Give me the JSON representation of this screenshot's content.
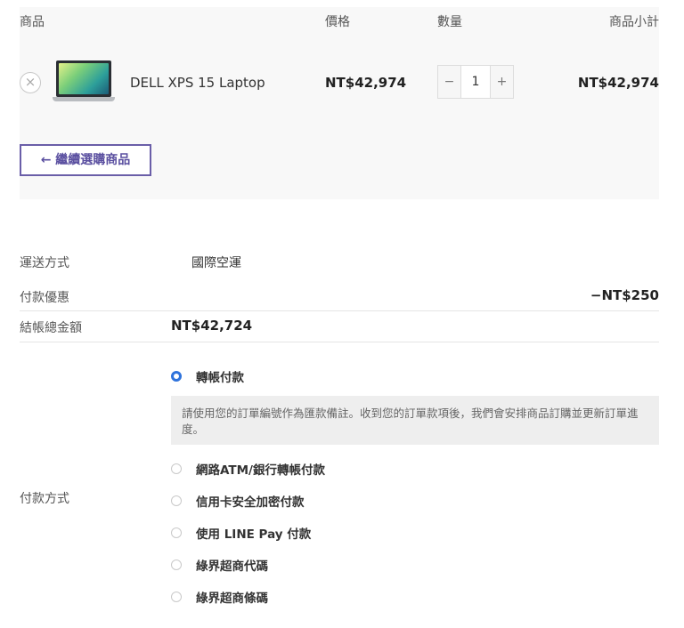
{
  "cart": {
    "headers": {
      "product": "商品",
      "price": "價格",
      "quantity": "數量",
      "subtotal": "商品小計"
    },
    "items": [
      {
        "remove_symbol": "×",
        "name": "DELL XPS 15 Laptop",
        "price": "NT$42,974",
        "qty_minus": "−",
        "quantity": "1",
        "qty_plus": "+",
        "subtotal": "NT$42,974"
      }
    ],
    "continue_button": "← 繼續選購商品"
  },
  "summary": {
    "shipping_label": "運送方式",
    "shipping_value": "國際空運",
    "discount_label": "付款優惠",
    "discount_value": "−NT$250",
    "total_label": "結帳總金額",
    "total_value": "NT$42,724"
  },
  "payment": {
    "label": "付款方式",
    "selected_index": 0,
    "options": [
      {
        "label": "轉帳付款"
      },
      {
        "label": "網路ATM/銀行轉帳付款"
      },
      {
        "label": "信用卡安全加密付款"
      },
      {
        "label": "使用 LINE Pay 付款"
      },
      {
        "label": "綠界超商代碼"
      },
      {
        "label": "綠界超商條碼"
      }
    ],
    "transfer_note": "請使用您的訂單編號作為匯款備註。收到您的訂單款項後，我們會安排商品訂購並更新訂單進度。"
  },
  "colors": {
    "accent": "#6a5ea8",
    "radio_selected": "#2f73dc",
    "panel_bg": "#f8f8f8",
    "note_bg": "#eeeeee"
  },
  "icons": {
    "remove": "close-circle-icon",
    "product_image": "laptop-thumbnail"
  }
}
